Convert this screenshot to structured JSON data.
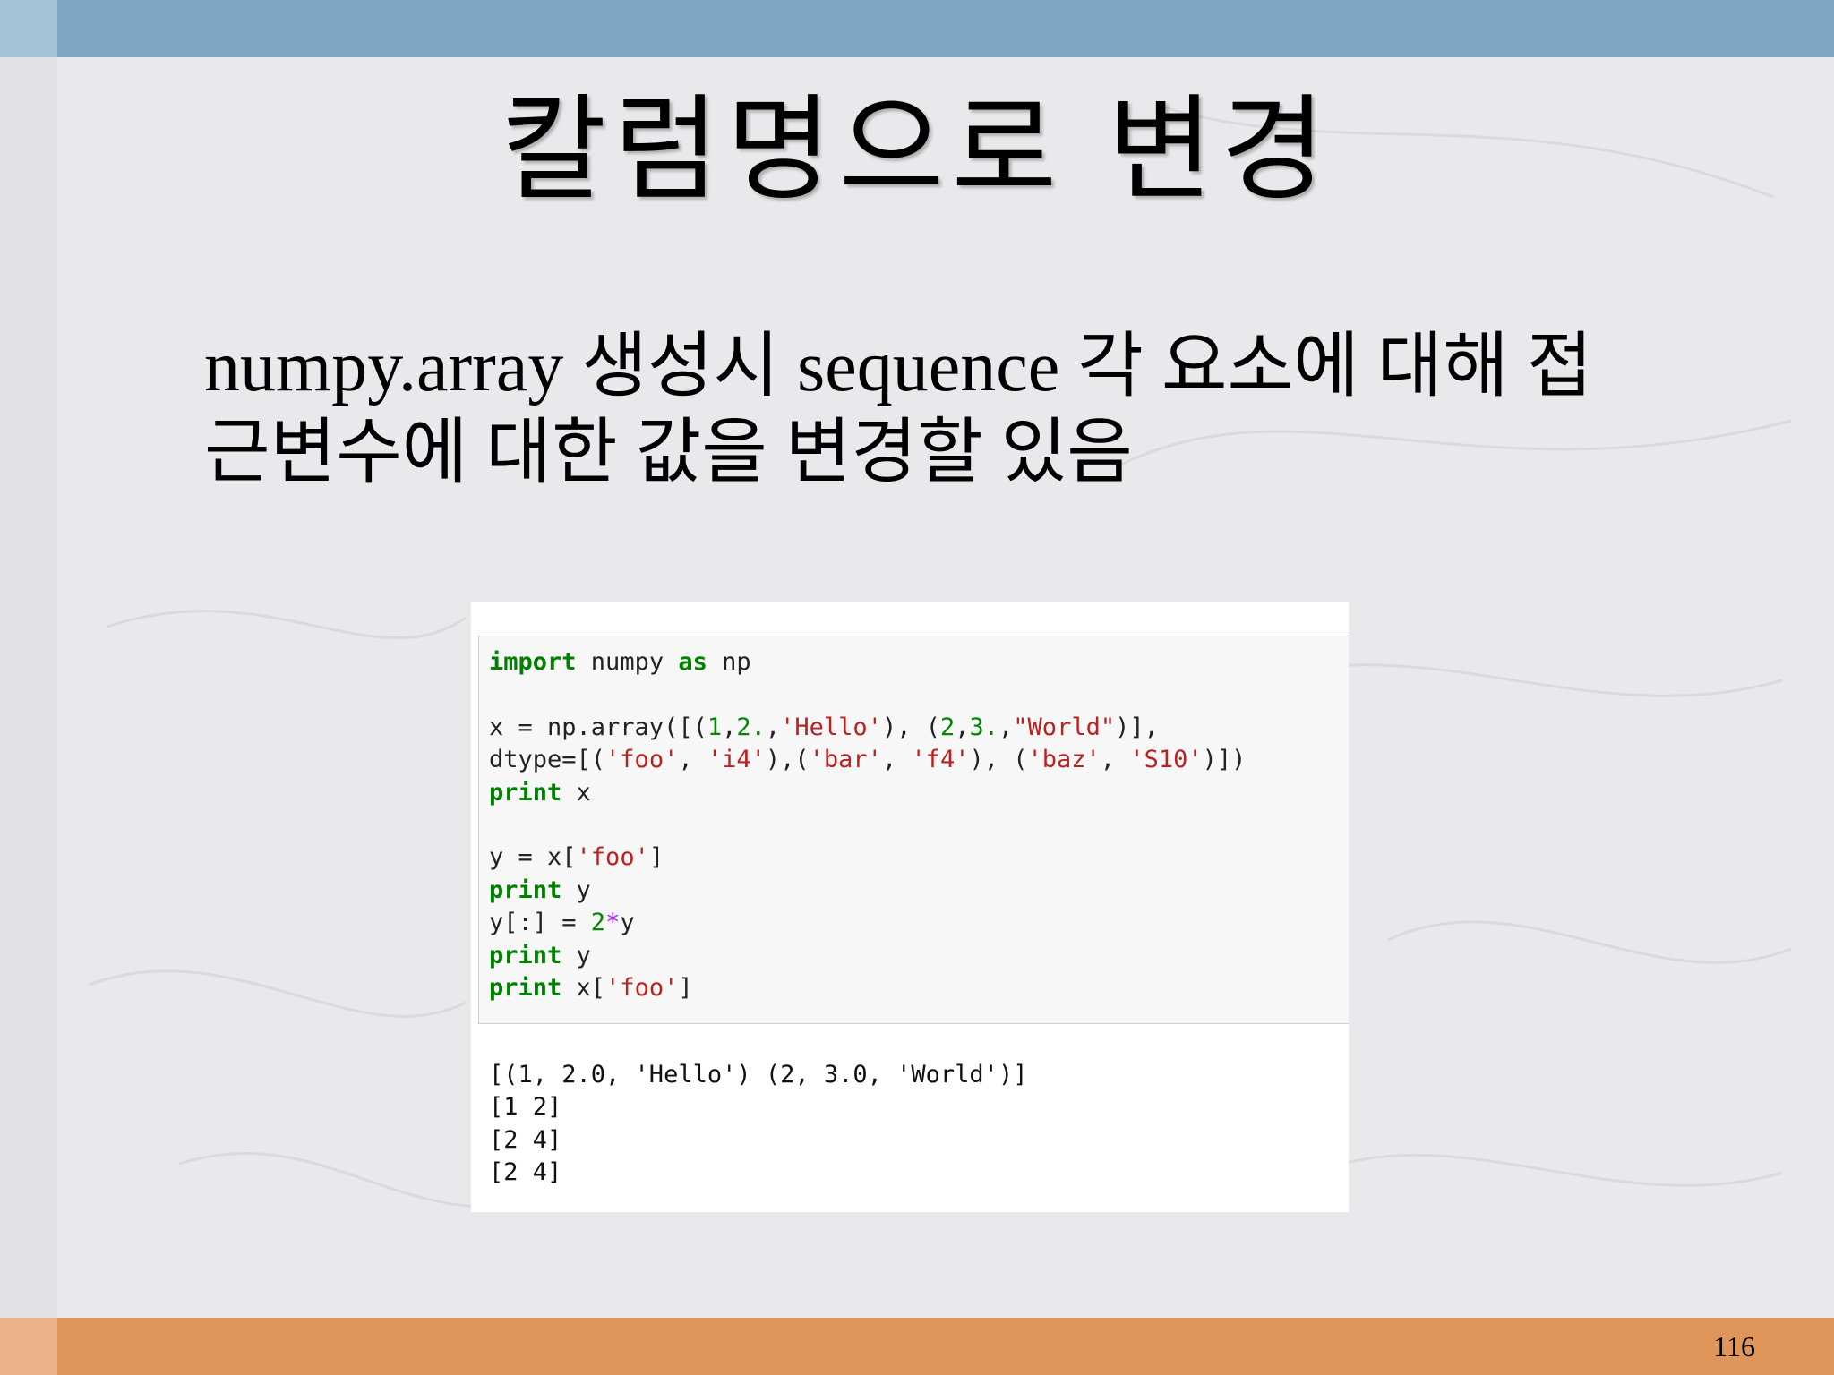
{
  "slide": {
    "title": "칼럼명으로 변경",
    "body_lines": [
      "numpy.array 생성시 sequence 각 요소에 대해 접",
      "근변수에 대한 값을 변경할 있음"
    ],
    "page_number": "116"
  },
  "notebook": {
    "code": {
      "line1": {
        "kw": "import",
        "rest": " numpy ",
        "kw2": "as",
        "rest2": " np"
      },
      "line3": {
        "a": "x = np.array([(",
        "n1": "1",
        "b": ",",
        "n2": "2.",
        "c": ",",
        "s1": "'Hello'",
        "d": "), (",
        "n3": "2",
        "e": ",",
        "n4": "3.",
        "f": ",",
        "s2": "\"World\"",
        "g": ")],"
      },
      "line4": {
        "a": "dtype=[(",
        "s1": "'foo'",
        "b": ", ",
        "s2": "'i4'",
        "c": "),(",
        "s3": "'bar'",
        "d": ", ",
        "s4": "'f4'",
        "e": "), (",
        "s5": "'baz'",
        "f": ", ",
        "s6": "'S10'",
        "g": ")])"
      },
      "line5": {
        "kw": "print",
        "rest": " x"
      },
      "line7": {
        "a": "y = x[",
        "s": "'foo'",
        "b": "]"
      },
      "line8": {
        "kw": "print",
        "rest": " y"
      },
      "line9": {
        "a": "y[:] = ",
        "n": "2",
        "op": "*",
        "b": "y"
      },
      "line10": {
        "kw": "print",
        "rest": " y"
      },
      "line11": {
        "kw": "print",
        "rest": " x[",
        "s": "'foo'",
        "b": "]"
      }
    },
    "output": [
      "[(1, 2.0, 'Hello') (2, 3.0, 'World')]",
      "[1 2]",
      "[2 4]",
      "[2 4]"
    ]
  },
  "colors": {
    "top_bar": "#7fa6c2",
    "bottom_bar": "#e0955a",
    "keyword": "#008000",
    "string": "#ba2121"
  }
}
